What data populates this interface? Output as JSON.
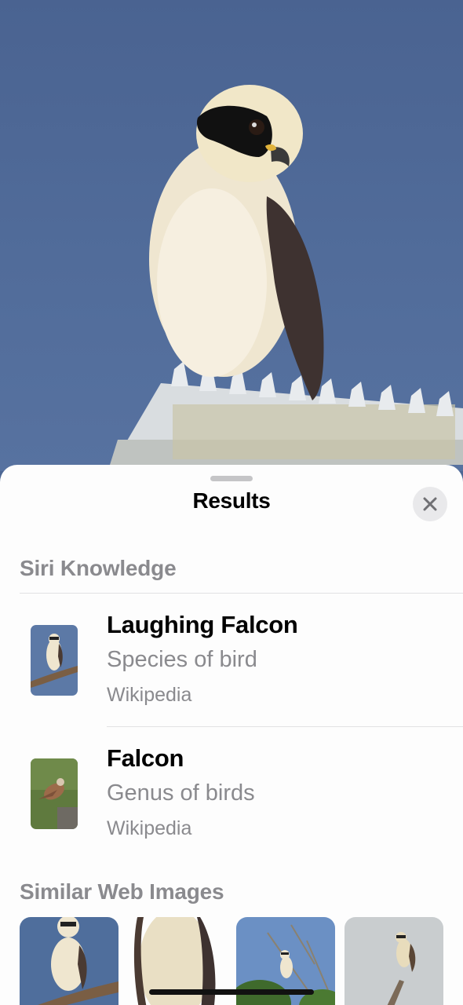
{
  "photo": {
    "subject": "laughing falcon perched on a streetlight"
  },
  "sheet": {
    "title": "Results",
    "close_icon": "close-icon"
  },
  "siri_knowledge": {
    "header": "Siri Knowledge",
    "results": [
      {
        "name": "Laughing Falcon",
        "description": "Species of bird",
        "source": "Wikipedia"
      },
      {
        "name": "Falcon",
        "description": "Genus of birds",
        "source": "Wikipedia"
      }
    ]
  },
  "web_images": {
    "header": "Similar Web Images"
  },
  "colors": {
    "sky": "#4d6794",
    "sheet_bg": "#fdfdfd",
    "secondary_text": "#8a8a8e",
    "close_button_bg": "#e9e9eb"
  }
}
